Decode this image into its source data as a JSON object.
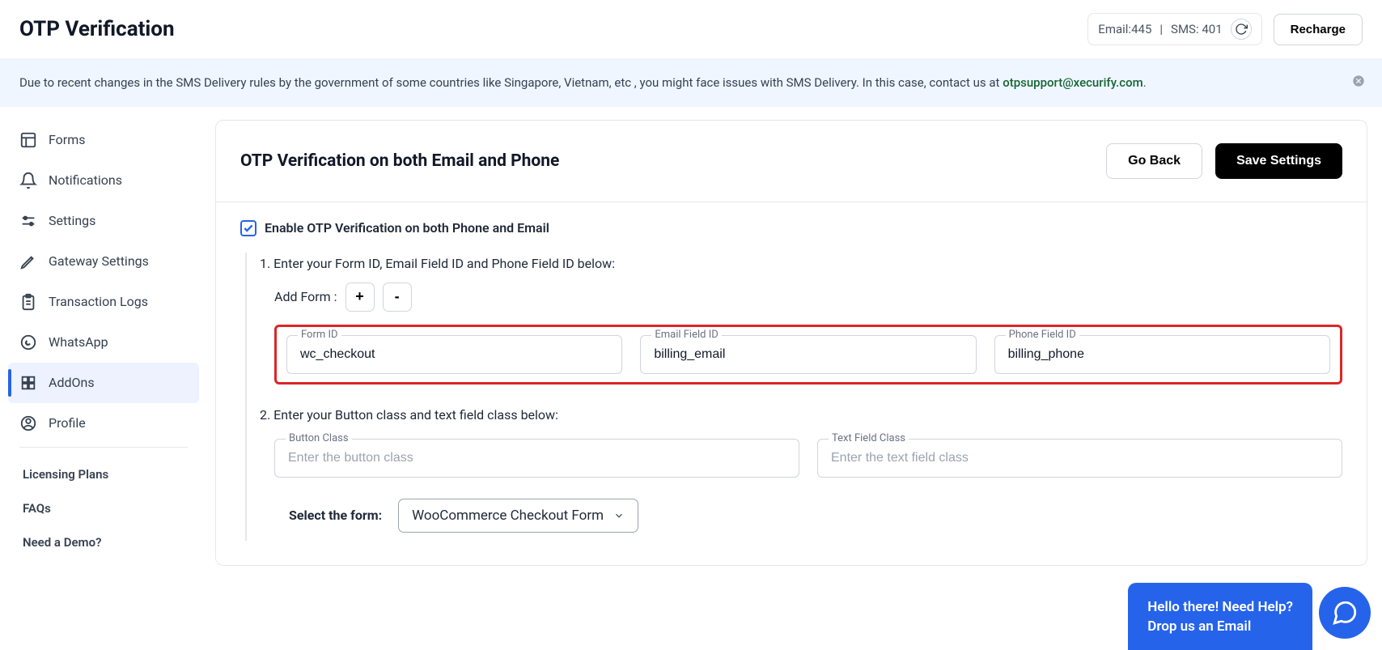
{
  "header": {
    "title": "OTP Verification",
    "credits_email_label": "Email:",
    "credits_email_value": "445",
    "credits_sms_label": "SMS:",
    "credits_sms_value": "401",
    "recharge": "Recharge"
  },
  "alert": {
    "text": "Due to recent changes in the SMS Delivery rules by the government of some countries like Singapore, Vietnam, etc , you might face issues with SMS Delivery. In this case, contact us at ",
    "email": "otpsupport@xecurify.com",
    "period": "."
  },
  "sidebar": {
    "items": [
      {
        "label": "Forms"
      },
      {
        "label": "Notifications"
      },
      {
        "label": "Settings"
      },
      {
        "label": "Gateway Settings"
      },
      {
        "label": "Transaction Logs"
      },
      {
        "label": "WhatsApp"
      },
      {
        "label": "AddOns"
      },
      {
        "label": "Profile"
      }
    ],
    "links": [
      {
        "label": "Licensing Plans"
      },
      {
        "label": "FAQs"
      },
      {
        "label": "Need a Demo?"
      }
    ]
  },
  "card": {
    "title": "OTP Verification on both Email and Phone",
    "go_back": "Go Back",
    "save": "Save Settings",
    "enable_label": "Enable OTP Verification on both Phone and Email",
    "enable_checked": true,
    "step1": "1. Enter your Form ID, Email Field ID and Phone Field ID below:",
    "add_form_label": "Add Form :",
    "plus": "+",
    "minus": "-",
    "form_id_label": "Form ID",
    "form_id_value": "wc_checkout",
    "email_field_label": "Email Field ID",
    "email_field_value": "billing_email",
    "phone_field_label": "Phone Field ID",
    "phone_field_value": "billing_phone",
    "step2": "2. Enter your Button class and text field class below:",
    "button_class_label": "Button Class",
    "button_class_placeholder": "Enter the button class",
    "text_class_label": "Text Field Class",
    "text_class_placeholder": "Enter the text field class",
    "select_label": "Select the form:",
    "select_value": "WooCommerce Checkout Form"
  },
  "help": {
    "line1": "Hello there! Need Help?",
    "line2": "Drop us an Email"
  }
}
